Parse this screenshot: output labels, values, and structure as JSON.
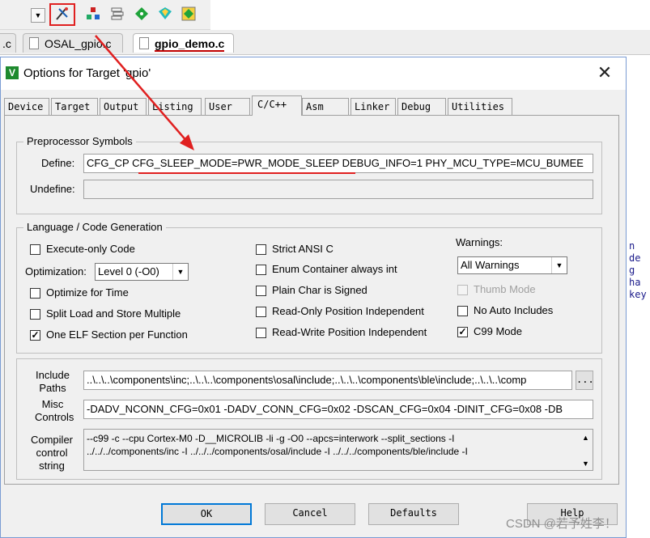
{
  "ide": {
    "tabs": [
      {
        "label": ".c"
      },
      {
        "label": "OSAL_gpio.c"
      },
      {
        "label": "gpio_demo.c"
      }
    ],
    "code_lines": [
      "n de",
      "g ha",
      "key"
    ],
    "brace": "}"
  },
  "dialog": {
    "title": "Options for Target 'gpio'",
    "title_icon": "V",
    "close": "✕",
    "tabs": [
      "Device",
      "Target",
      "Output",
      "Listing",
      "User",
      "C/C++",
      "Asm",
      "Linker",
      "Debug",
      "Utilities"
    ],
    "active_tab": "C/C++",
    "preprocessor": {
      "group_label": "Preprocessor Symbols",
      "define_label": "Define:",
      "define_value": "CFG_CP   CFG_SLEEP_MODE=PWR_MODE_SLEEP DEBUG_INFO=1 PHY_MCU_TYPE=MCU_BUMEE",
      "undefine_label": "Undefine:",
      "undefine_value": ""
    },
    "language": {
      "group_label": "Language / Code Generation",
      "execute_only": {
        "label": "Execute-only Code",
        "checked": false
      },
      "optimization_label": "Optimization:",
      "optimization_value": "Level 0 (-O0)",
      "optimize_time": {
        "label": "Optimize for Time",
        "checked": false
      },
      "split_load": {
        "label": "Split Load and Store Multiple",
        "checked": false
      },
      "one_elf": {
        "label": "One ELF Section per Function",
        "checked": true
      },
      "strict_ansi": {
        "label": "Strict ANSI C",
        "checked": false
      },
      "enum_container": {
        "label": "Enum Container always int",
        "checked": false
      },
      "plain_char": {
        "label": "Plain Char is Signed",
        "checked": false
      },
      "ro_pos": {
        "label": "Read-Only Position Independent",
        "checked": false
      },
      "rw_pos": {
        "label": "Read-Write Position Independent",
        "checked": false
      },
      "warnings_label": "Warnings:",
      "warnings_value": "All Warnings",
      "thumb_mode": {
        "label": "Thumb Mode",
        "checked": false,
        "disabled": true
      },
      "no_auto_includes": {
        "label": "No Auto Includes",
        "checked": false
      },
      "c99_mode": {
        "label": "C99 Mode",
        "checked": true
      }
    },
    "include_paths": {
      "label_line1": "Include",
      "label_line2": "Paths",
      "value": "..\\..\\..\\components\\inc;..\\..\\..\\components\\osal\\include;..\\..\\..\\components\\ble\\include;..\\..\\..\\comp",
      "browse": "..."
    },
    "misc_controls": {
      "label_line1": "Misc",
      "label_line2": "Controls",
      "value": "-DADV_NCONN_CFG=0x01  -DADV_CONN_CFG=0x02  -DSCAN_CFG=0x04   -DINIT_CFG=0x08  -DB"
    },
    "compiler_control": {
      "label_line1": "Compiler",
      "label_line2": "control",
      "label_line3": "string",
      "line1": "--c99 -c --cpu Cortex-M0 -D__MICROLIB -li -g -O0 --apcs=interwork --split_sections -I",
      "line2": "../../../components/inc -I ../../../components/osal/include -I ../../../components/ble/include -I"
    },
    "buttons": {
      "ok": "OK",
      "cancel": "Cancel",
      "defaults": "Defaults",
      "help": "Help"
    }
  },
  "watermark": "CSDN @若予姓李！",
  "annotation_color": "#e02020"
}
